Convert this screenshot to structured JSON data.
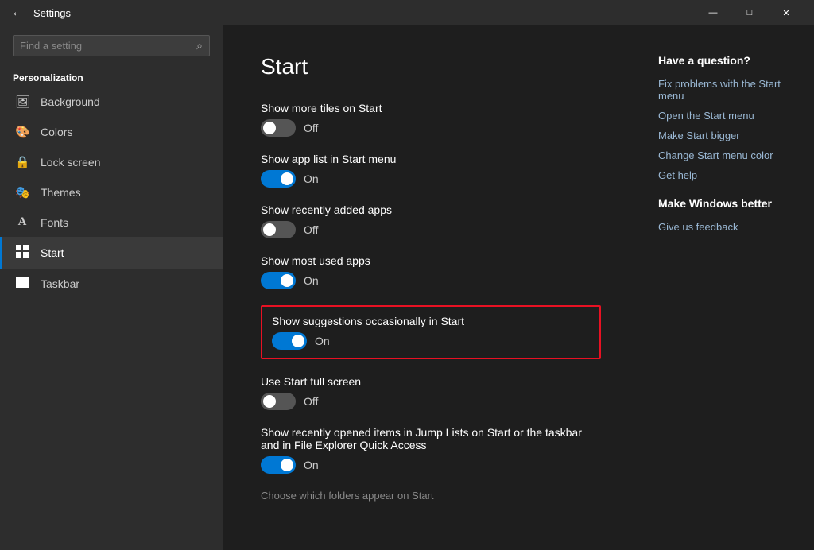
{
  "titlebar": {
    "back_icon": "←",
    "title": "Settings",
    "minimize": "—",
    "maximize": "□",
    "close": "✕"
  },
  "sidebar": {
    "search_placeholder": "Find a setting",
    "search_icon": "🔍",
    "section_label": "Personalization",
    "items": [
      {
        "id": "background",
        "label": "Background",
        "icon": "🖼"
      },
      {
        "id": "colors",
        "label": "Colors",
        "icon": "🎨"
      },
      {
        "id": "lock-screen",
        "label": "Lock screen",
        "icon": "🔒"
      },
      {
        "id": "themes",
        "label": "Themes",
        "icon": "🎭"
      },
      {
        "id": "fonts",
        "label": "Fonts",
        "icon": "A"
      },
      {
        "id": "start",
        "label": "Start",
        "icon": "▦"
      },
      {
        "id": "taskbar",
        "label": "Taskbar",
        "icon": "▬"
      }
    ]
  },
  "content": {
    "title": "Start",
    "settings": [
      {
        "id": "show-more-tiles",
        "label": "Show more tiles on Start",
        "state": "off",
        "state_label": "Off"
      },
      {
        "id": "show-app-list",
        "label": "Show app list in Start menu",
        "state": "on",
        "state_label": "On"
      },
      {
        "id": "show-recently-added",
        "label": "Show recently added apps",
        "state": "off",
        "state_label": "Off"
      },
      {
        "id": "show-most-used",
        "label": "Show most used apps",
        "state": "on",
        "state_label": "On"
      }
    ],
    "highlighted_setting": {
      "id": "show-suggestions",
      "label": "Show suggestions occasionally in Start",
      "state": "on",
      "state_label": "On"
    },
    "settings2": [
      {
        "id": "use-full-screen",
        "label": "Use Start full screen",
        "state": "off",
        "state_label": "Off"
      },
      {
        "id": "show-recent-items",
        "label": "Show recently opened items in Jump Lists on Start or the taskbar and in File Explorer Quick Access",
        "state": "on",
        "state_label": "On"
      }
    ],
    "choose_folders_label": "Choose which folders appear on Start"
  },
  "right_panel": {
    "section1_title": "Have a question?",
    "links1": [
      "Fix problems with the Start menu",
      "Open the Start menu",
      "Make Start bigger",
      "Change Start menu color",
      "Get help"
    ],
    "section2_title": "Make Windows better",
    "links2": [
      "Give us feedback"
    ]
  }
}
